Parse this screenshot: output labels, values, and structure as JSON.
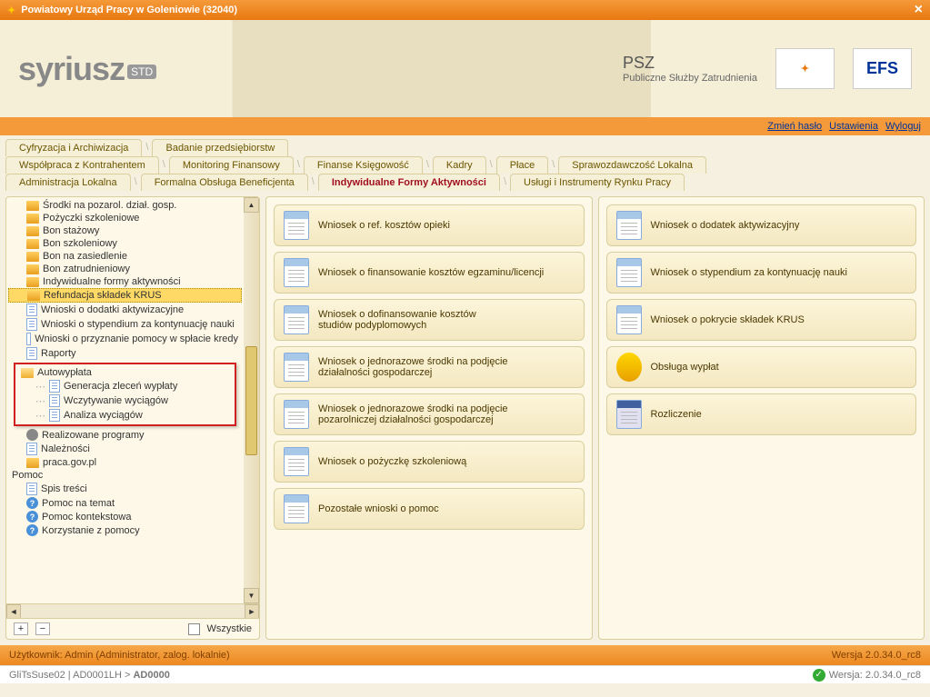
{
  "window": {
    "title": "Powiatowy Urząd Pracy w Goleniowie (32040)"
  },
  "logo": {
    "name": "syriusz",
    "suffix": "STD"
  },
  "psz": {
    "short": "PSZ",
    "full": "Publiczne Służby Zatrudnienia"
  },
  "badges": {
    "syriusz": "SYRIUSZ",
    "efs": "EFS"
  },
  "header_links": {
    "pass": "Zmień hasło",
    "settings": "Ustawienia",
    "logout": "Wyloguj"
  },
  "tabs": {
    "row1": [
      "Cyfryzacja i Archiwizacja",
      "Badanie przedsiębiorstw"
    ],
    "row2": [
      "Współpraca z Kontrahentem",
      "Monitoring Finansowy",
      "Finanse Księgowość",
      "Kadry",
      "Płace",
      "Sprawozdawczość Lokalna"
    ],
    "row3": [
      "Administracja Lokalna",
      "Formalna Obsługa Beneficjenta",
      "Indywidualne Formy Aktywności",
      "Usługi i Instrumenty Rynku Pracy"
    ]
  },
  "tree": {
    "items": [
      {
        "t": "folder",
        "l": "Środki na pozarol. dział. gosp."
      },
      {
        "t": "folder",
        "l": "Pożyczki szkoleniowe"
      },
      {
        "t": "folder",
        "l": "Bon stażowy"
      },
      {
        "t": "folder",
        "l": "Bon szkoleniowy"
      },
      {
        "t": "folder",
        "l": "Bon na zasiedlenie"
      },
      {
        "t": "folder",
        "l": "Bon zatrudnieniowy"
      },
      {
        "t": "folder",
        "l": "Indywidualne formy aktywności"
      },
      {
        "t": "folder",
        "l": "Refundacja składek KRUS",
        "hl": true
      },
      {
        "t": "doc",
        "l": "Wnioski o dodatki aktywizacyjne"
      },
      {
        "t": "doc",
        "l": "Wnioski o stypendium za kontynuację nauki"
      },
      {
        "t": "doc",
        "l": "Wnioski o przyznanie pomocy w spłacie kredy"
      },
      {
        "t": "doc",
        "l": "Raporty"
      }
    ],
    "boxed": {
      "parent": "Autowypłata",
      "children": [
        "Generacja zleceń wypłaty",
        "Wczytywanie wyciągów",
        "Analiza wyciągów"
      ]
    },
    "after": [
      {
        "t": "gear",
        "l": "Realizowane programy"
      },
      {
        "t": "doc",
        "l": "Należności"
      },
      {
        "t": "folder",
        "l": "praca.gov.pl"
      }
    ],
    "pomoc_header": "Pomoc",
    "pomoc": [
      {
        "t": "doc",
        "l": "Spis treści"
      },
      {
        "t": "help",
        "l": "Pomoc na temat"
      },
      {
        "t": "help",
        "l": "Pomoc kontekstowa"
      },
      {
        "t": "help",
        "l": "Korzystanie z pomocy"
      }
    ],
    "all_label": "Wszystkie"
  },
  "buttons": {
    "col1": [
      "Wniosek o ref. kosztów opieki",
      "Wniosek o finansowanie kosztów egzaminu/licencji",
      "Wniosek o dofinansowanie kosztów\nstudiów podyplomowych",
      "Wniosek o jednorazowe środki na podjęcie\ndziałalności gospodarczej",
      "Wniosek o jednorazowe środki na podjęcie\npozarolniczej działalności gospodarczej",
      "Wniosek o pożyczkę szkoleniową",
      "Pozostałe wnioski o pomoc"
    ],
    "col2": [
      {
        "l": "Wniosek o dodatek aktywizacyjny",
        "i": "doc"
      },
      {
        "l": "Wniosek o stypendium za kontynuację nauki",
        "i": "doc"
      },
      {
        "l": "Wniosek o pokrycie składek KRUS",
        "i": "doc"
      },
      {
        "l": "Obsługa wypłat",
        "i": "money"
      },
      {
        "l": "Rozliczenie",
        "i": "calc"
      }
    ]
  },
  "footer": {
    "user": "Użytkownik: Admin (Administrator, zalog. lokalnie)",
    "ver": "Wersja 2.0.34.0_rc8",
    "host": "GliTsSuse02 | AD0001LH > ",
    "code": "AD0000",
    "ver2": "Wersja: 2.0.34.0_rc8"
  }
}
